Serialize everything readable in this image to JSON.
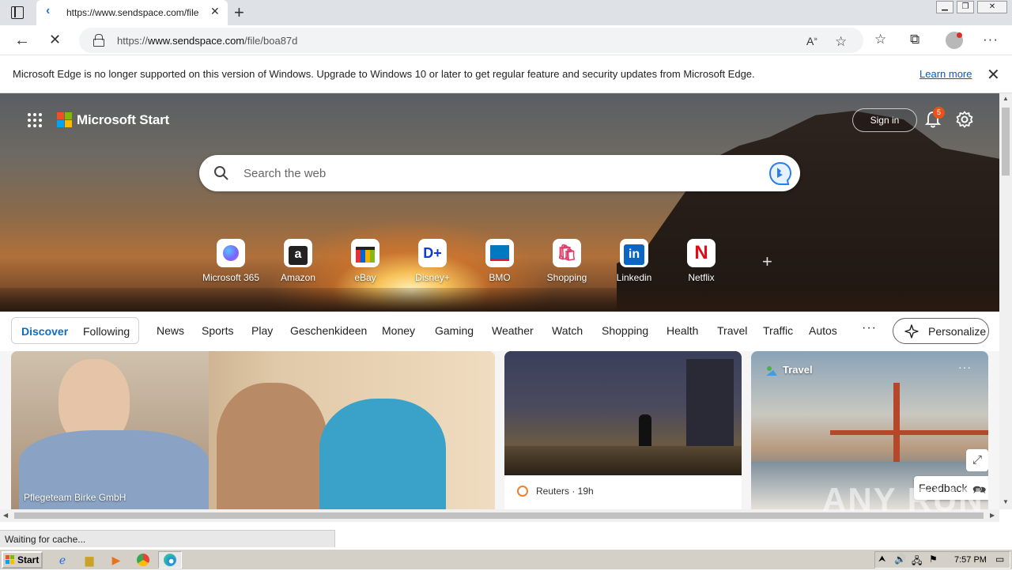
{
  "browser": {
    "tab_title": "https://www.sendspace.com/file",
    "url_prefix": "https://",
    "url_domain": "www.sendspace.com",
    "url_path": "/file/boa87d"
  },
  "infobar": {
    "message": "Microsoft Edge is no longer supported on this version of Windows. Upgrade to Windows 10 or later to get regular feature and security updates from Microsoft Edge.",
    "link": "Learn more"
  },
  "start": {
    "brand": "Microsoft Start",
    "signin": "Sign in",
    "notification_count": "5",
    "search_placeholder": "Search the web",
    "tiles": [
      {
        "label": "Microsoft 365",
        "icon": "ms365-icon",
        "color": "#7b61ff"
      },
      {
        "label": "Amazon",
        "icon": "amazon-icon",
        "color": "#222222"
      },
      {
        "label": "eBay",
        "icon": "ebay-icon",
        "color": "#e53238"
      },
      {
        "label": "Disney+",
        "icon": "disney-icon",
        "color": "#113ccf"
      },
      {
        "label": "BMO",
        "icon": "bmo-icon",
        "color": "#0079c1"
      },
      {
        "label": "Shopping",
        "icon": "shopping-icon",
        "color": "#e03d6a"
      },
      {
        "label": "Linkedin",
        "icon": "linkedin-icon",
        "color": "#0a66c2"
      },
      {
        "label": "Netflix",
        "icon": "netflix-icon",
        "color": "#e50914"
      }
    ]
  },
  "nav": {
    "discover": "Discover",
    "following": "Following",
    "items": [
      "News",
      "Sports",
      "Play",
      "Geschenkideen",
      "Money",
      "Gaming",
      "Weather",
      "Watch",
      "Shopping",
      "Health",
      "Travel",
      "Traffic",
      "Autos"
    ],
    "more": "···",
    "personalize": "Personalize"
  },
  "feed": {
    "main_caption": "Pflegeteam Birke GmbH",
    "news_source": "Reuters · 19h",
    "travel_label": "Travel",
    "feedback": "Feedback"
  },
  "status": {
    "text": "Waiting for cache..."
  },
  "taskbar": {
    "start": "Start",
    "clock": "7:57 PM"
  },
  "watermark": "ANY RUN"
}
